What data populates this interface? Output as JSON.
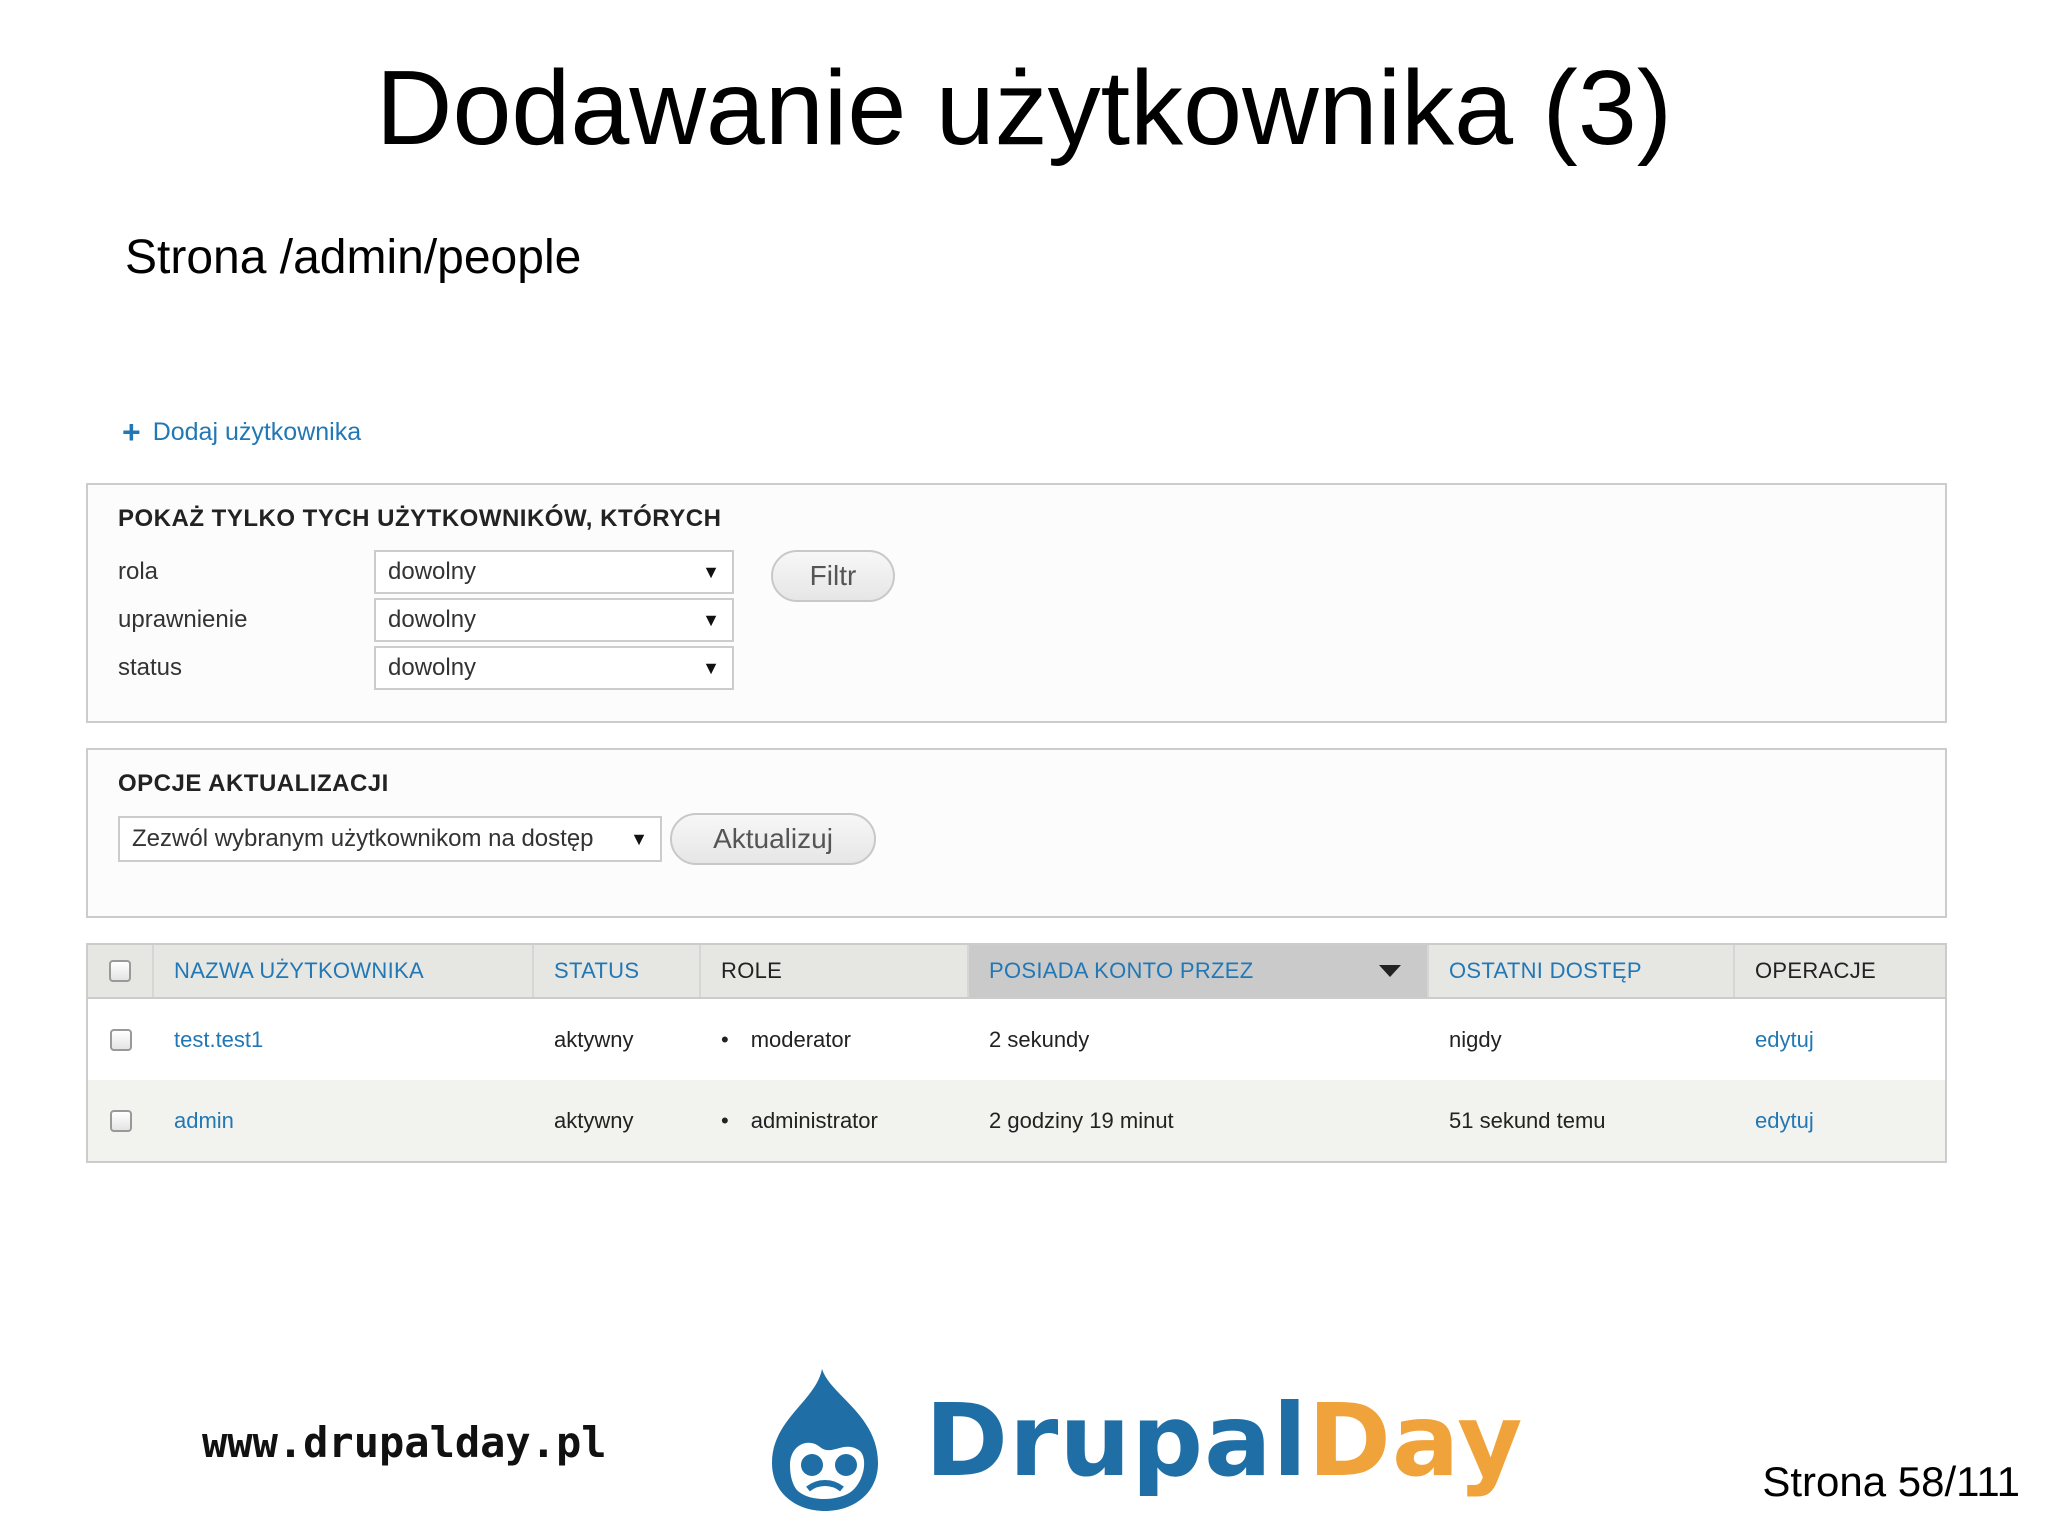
{
  "slide": {
    "title": "Dodawanie użytkownika (3)",
    "subtitle": "Strona /admin/people"
  },
  "actions": {
    "add_user_icon": "+",
    "add_user": "Dodaj użytkownika"
  },
  "filter": {
    "legend": "POKAŻ TYLKO TYCH UŻYTKOWNIKÓW, KTÓRYCH",
    "rows": [
      {
        "label": "rola",
        "value": "dowolny"
      },
      {
        "label": "uprawnienie",
        "value": "dowolny"
      },
      {
        "label": "status",
        "value": "dowolny"
      }
    ],
    "button": "Filtr"
  },
  "update": {
    "legend": "OPCJE AKTUALIZACJI",
    "selected": "Zezwól wybranym użytkownikom na dostęp",
    "button": "Aktualizuj"
  },
  "table": {
    "headers": [
      "NAZWA UŻYTKOWNIKA",
      "STATUS",
      "ROLE",
      "POSIADA KONTO PRZEZ",
      "OSTATNI DOSTĘP",
      "OPERACJE"
    ],
    "rows": [
      {
        "name": "test.test1",
        "status": "aktywny",
        "role": "moderator",
        "member_for": "2 sekundy",
        "last_access": "nigdy",
        "operation": "edytuj"
      },
      {
        "name": "admin",
        "status": "aktywny",
        "role": "administrator",
        "member_for": "2 godziny 19 minut",
        "last_access": "51 sekund temu",
        "operation": "edytuj"
      }
    ],
    "bullet": "•"
  },
  "footer": {
    "url": "www.drupalday.pl",
    "logo_part1": "Drupal",
    "logo_part2": "Day",
    "page": "Strona 58/111"
  },
  "colors": {
    "link": "#2278b5",
    "logo_blue": "#1f6fa6",
    "logo_orange": "#f0a33a"
  }
}
